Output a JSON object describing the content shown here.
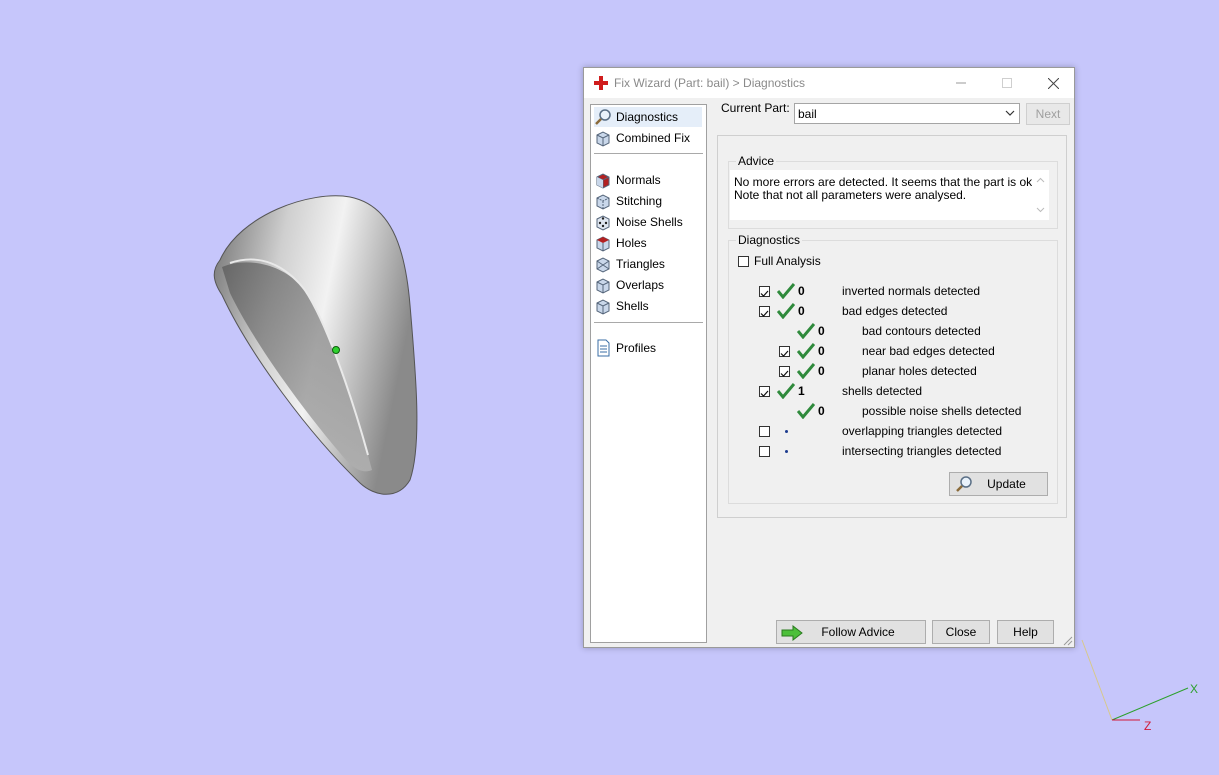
{
  "window": {
    "title": "Fix Wizard (Part: bail) > Diagnostics"
  },
  "nav": {
    "items": [
      {
        "label": "Diagnostics",
        "icon": "magnifier-icon",
        "selected": true
      },
      {
        "label": "Combined Fix",
        "icon": "cube-icon"
      },
      {
        "label": "Normals",
        "icon": "cube-red-icon"
      },
      {
        "label": "Stitching",
        "icon": "cube-icon"
      },
      {
        "label": "Noise Shells",
        "icon": "dice-icon"
      },
      {
        "label": "Holes",
        "icon": "cube-hole-icon"
      },
      {
        "label": "Triangles",
        "icon": "cube-icon"
      },
      {
        "label": "Overlaps",
        "icon": "cube-icon"
      },
      {
        "label": "Shells",
        "icon": "cube-icon"
      },
      {
        "label": "Profiles",
        "icon": "document-icon"
      }
    ]
  },
  "header": {
    "current_part_label": "Current Part:",
    "current_part_value": "bail",
    "next_label": "Next"
  },
  "advice": {
    "title": "Advice",
    "line1": "No more errors are detected. It seems that the part is ok.",
    "line2": "Note that not all parameters were analysed."
  },
  "diagnostics": {
    "title": "Diagnostics",
    "full_analysis_label": "Full Analysis",
    "full_analysis_checked": false,
    "rows": [
      {
        "label": "inverted normals detected",
        "count": "0",
        "checked": true,
        "status": "ok"
      },
      {
        "label": "bad edges detected",
        "count": "0",
        "checked": true,
        "status": "ok"
      },
      {
        "label": "bad contours detected",
        "count": "0",
        "status": "ok"
      },
      {
        "label": "near bad edges detected",
        "count": "0",
        "checked": true,
        "status": "ok"
      },
      {
        "label": "planar holes detected",
        "count": "0",
        "checked": true,
        "status": "ok"
      },
      {
        "label": "shells detected",
        "count": "1",
        "checked": true,
        "status": "ok"
      },
      {
        "label": "possible noise shells detected",
        "count": "0",
        "status": "ok"
      },
      {
        "label": "overlapping triangles detected",
        "checked": false,
        "status": "not-analysed"
      },
      {
        "label": "intersecting triangles detected",
        "checked": false,
        "status": "not-analysed"
      }
    ],
    "update_label": "Update"
  },
  "footer": {
    "follow_advice_label": "Follow Advice",
    "close_label": "Close",
    "help_label": "Help"
  },
  "viewport": {
    "axis_x": "X",
    "axis_z": "Z",
    "background": "#c6c6fb"
  },
  "colors": {
    "check_green": "#2f8a3c",
    "accent_red": "#d01d1d"
  }
}
